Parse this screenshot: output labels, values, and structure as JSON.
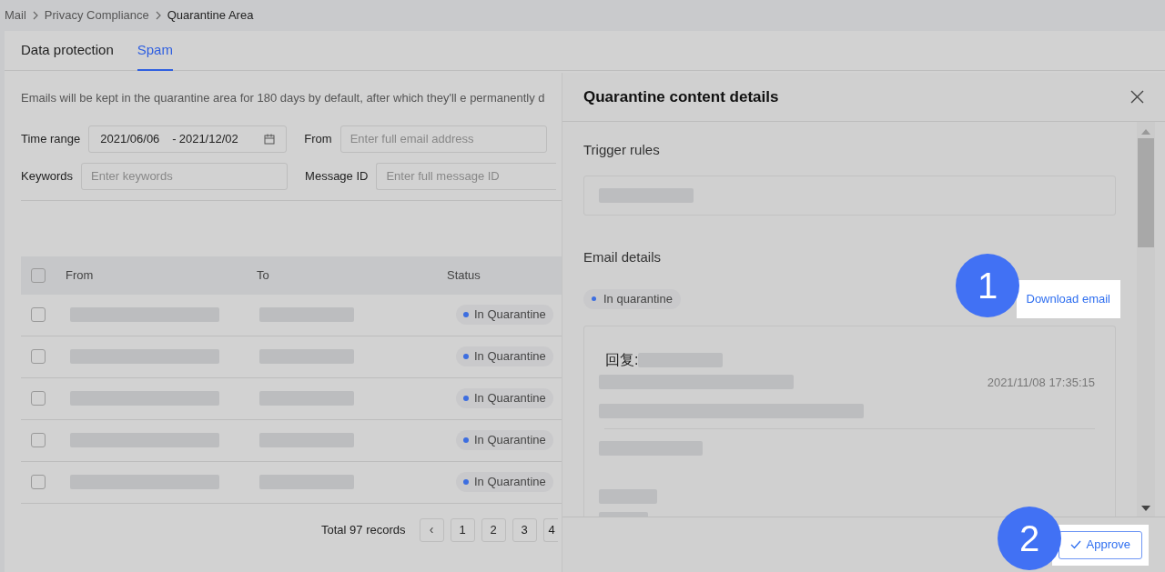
{
  "breadcrumb": [
    "Mail",
    "Privacy Compliance",
    "Quarantine Area"
  ],
  "tabs": [
    {
      "label": "Data protection",
      "selected": false
    },
    {
      "label": "Spam",
      "selected": true
    }
  ],
  "notice": "Emails will be kept in the quarantine area for 180 days by default, after which they'll e permanently d",
  "filters": {
    "time_range": {
      "label": "Time range",
      "start": "2021/06/06",
      "separator": "-",
      "end": "2021/12/02"
    },
    "from": {
      "label": "From",
      "placeholder": "Enter full email address"
    },
    "keywords": {
      "label": "Keywords",
      "placeholder": "Enter keywords"
    },
    "message_id": {
      "label": "Message ID",
      "placeholder": "Enter full message ID"
    }
  },
  "table": {
    "all_checked": false,
    "columns": [
      "From",
      "To",
      "Status"
    ],
    "rows": [
      {
        "checked": false,
        "status": "In Quarantine",
        "color": "#3d6ee0"
      },
      {
        "checked": false,
        "status": "In Quarantine",
        "color": "#3d6ee0"
      },
      {
        "checked": false,
        "status": "In Quarantine",
        "color": "#3d6ee0"
      },
      {
        "checked": false,
        "status": "In Quarantine",
        "color": "#3d6ee0"
      },
      {
        "checked": false,
        "status": "In Quarantine",
        "color": "#3d6ee0"
      }
    ]
  },
  "pagination": {
    "total": "Total 97 records",
    "prev": "‹",
    "pages": [
      "1",
      "2",
      "3",
      "4"
    ]
  },
  "drawer": {
    "title": "Quarantine content details",
    "trigger_rules": "Trigger rules",
    "email_details": "Email details",
    "status": {
      "label": "In quarantine",
      "color": "#3d6ee0"
    },
    "download": "Download email",
    "email": {
      "subject_prefix": "回复:",
      "date": "2021/11/08 17:35:15"
    },
    "approve": "Approve"
  },
  "callouts": [
    "1",
    "2"
  ]
}
